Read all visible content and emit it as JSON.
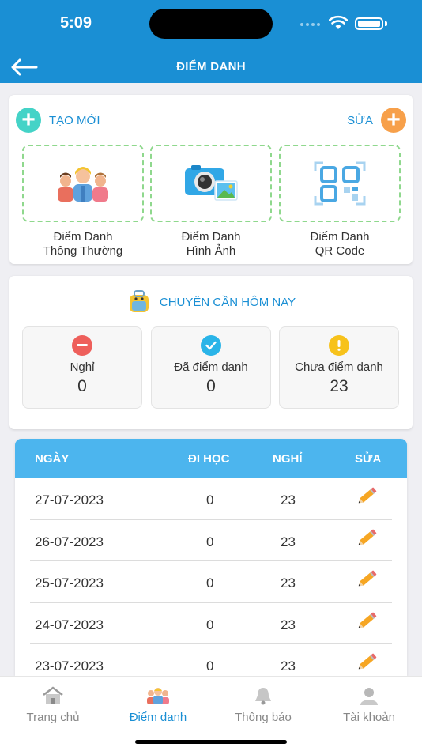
{
  "status_bar": {
    "time": "5:09"
  },
  "header": {
    "title": "ĐIỂM DANH"
  },
  "create_card": {
    "create_label": "TẠO MỚI",
    "edit_label": "SỬA",
    "options": [
      {
        "line1": "Điểm Danh",
        "line2": "Thông Thường",
        "icon": "students-icon"
      },
      {
        "line1": "Điểm Danh",
        "line2": "Hình Ảnh",
        "icon": "camera-icon"
      },
      {
        "line1": "Điểm Danh",
        "line2": "QR Code",
        "icon": "qr-code-icon"
      }
    ]
  },
  "attendance": {
    "title": "CHUYÊN CẦN HÔM NAY",
    "stats": [
      {
        "label": "Nghỉ",
        "value": "0",
        "color": "#ee5f5b"
      },
      {
        "label": "Đã điểm danh",
        "value": "0",
        "color": "#2ab4e8"
      },
      {
        "label": "Chưa điểm danh",
        "value": "23",
        "color": "#f7c21b"
      }
    ]
  },
  "table": {
    "headers": {
      "date": "NGÀY",
      "present": "ĐI HỌC",
      "absent": "NGHỈ",
      "edit": "SỬA"
    },
    "rows": [
      {
        "date": "27-07-2023",
        "present": "0",
        "absent": "23"
      },
      {
        "date": "26-07-2023",
        "present": "0",
        "absent": "23"
      },
      {
        "date": "25-07-2023",
        "present": "0",
        "absent": "23"
      },
      {
        "date": "24-07-2023",
        "present": "0",
        "absent": "23"
      },
      {
        "date": "23-07-2023",
        "present": "0",
        "absent": "23"
      }
    ]
  },
  "bottom_nav": {
    "items": [
      {
        "label": "Trang chủ",
        "icon": "house-icon"
      },
      {
        "label": "Điểm danh",
        "icon": "students-icon",
        "active": true
      },
      {
        "label": "Thông báo",
        "icon": "bell-icon"
      },
      {
        "label": "Tài khoản",
        "icon": "account-icon"
      }
    ]
  },
  "colors": {
    "primary": "#1a8fd4",
    "table_header": "#4cb5ee",
    "dashed_border": "#8fd88d"
  }
}
